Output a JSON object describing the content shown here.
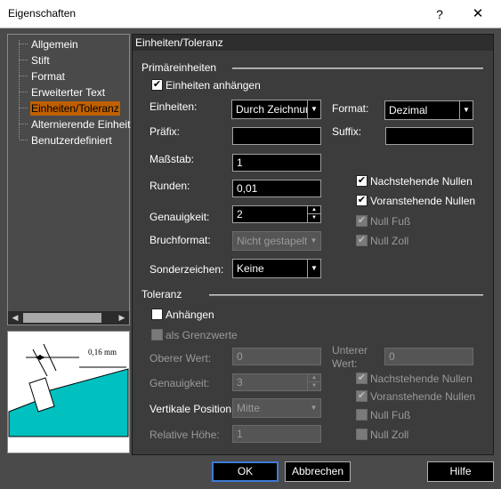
{
  "window": {
    "title": "Eigenschaften",
    "help_glyph": "?",
    "close_glyph": "✕"
  },
  "tree": {
    "items": [
      {
        "label": "Allgemein"
      },
      {
        "label": "Stift"
      },
      {
        "label": "Format"
      },
      {
        "label": "Erweiterter Text"
      },
      {
        "label": "Einheiten/Toleranz",
        "selected": true
      },
      {
        "label": "Alternierende Einheit"
      },
      {
        "label": "Benutzerdefiniert"
      }
    ],
    "scroll_left": "◀",
    "scroll_right": "▶"
  },
  "preview": {
    "dimension_text": "0,16 mm",
    "fill_color": "#00c0c0"
  },
  "panel": {
    "header": "Einheiten/Toleranz",
    "primary": {
      "group_label": "Primäreinheiten",
      "append_units": {
        "label": "Einheiten anhängen",
        "checked": true
      },
      "units": {
        "label": "Einheiten:",
        "value": "Durch Zeichnung"
      },
      "format": {
        "label": "Format:",
        "value": "Dezimal"
      },
      "prefix": {
        "label": "Präfix:",
        "value": ""
      },
      "suffix": {
        "label": "Suffix:",
        "value": ""
      },
      "scale": {
        "label": "Maßstab:",
        "value": "1"
      },
      "rounding": {
        "label": "Runden:",
        "value": "0,01"
      },
      "precision": {
        "label": "Genauigkeit:",
        "value": "2"
      },
      "fraction_format": {
        "label": "Bruchformat:",
        "value": "Nicht gestapelt"
      },
      "special_chars": {
        "label": "Sonderzeichen:",
        "value": "Keine"
      },
      "trailing_zeros": {
        "label": "Nachstehende Nullen",
        "checked": true
      },
      "leading_zeros": {
        "label": "Voranstehende Nullen",
        "checked": true
      },
      "zero_feet": {
        "label": "Null Fuß",
        "checked": true
      },
      "zero_inch": {
        "label": "Null Zoll",
        "checked": true
      }
    },
    "tolerance": {
      "group_label": "Toleranz",
      "append": {
        "label": "Anhängen",
        "checked": false
      },
      "as_limits": {
        "label": "als Grenzwerte",
        "checked": false
      },
      "upper": {
        "label": "Oberer Wert:",
        "value": "0"
      },
      "lower": {
        "label_line1": "Unterer",
        "label_line2": "Wert:",
        "value": "0"
      },
      "precision": {
        "label": "Genauigkeit:",
        "value": "3"
      },
      "vertical_position": {
        "label": "Vertikale Position:",
        "value": "Mitte"
      },
      "relative_height": {
        "label": "Relative Höhe:",
        "value": "1"
      },
      "trailing_zeros": {
        "label": "Nachstehende Nullen",
        "checked": true
      },
      "leading_zeros": {
        "label": "Voranstehende Nullen",
        "checked": true
      },
      "zero_feet": {
        "label": "Null Fuß",
        "checked": false
      },
      "zero_inch": {
        "label": "Null Zoll",
        "checked": false
      }
    }
  },
  "buttons": {
    "ok": "OK",
    "cancel": "Abbrechen",
    "help": "Hilfe"
  },
  "glyphs": {
    "check": "✔",
    "dropdown": "▼",
    "spin_up": "▲",
    "spin_down": "▼"
  }
}
